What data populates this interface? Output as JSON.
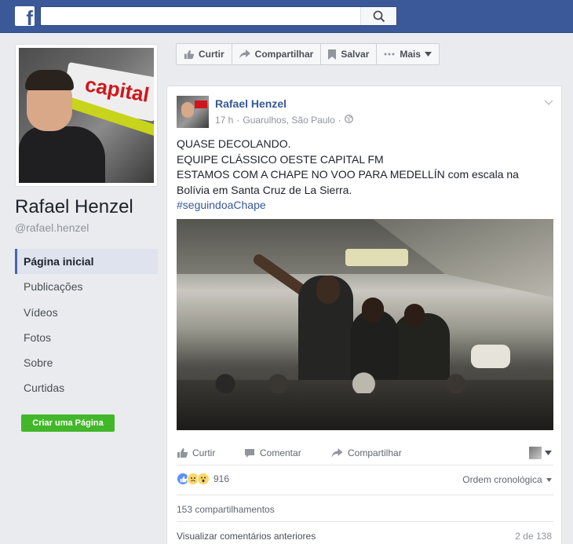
{
  "topbar": {
    "logo": "f",
    "search_placeholder": ""
  },
  "profile": {
    "name": "Rafael Henzel",
    "handle": "@rafael.henzel",
    "avatar_sign_text": "capital"
  },
  "nav": {
    "items": [
      {
        "label": "Página inicial",
        "active": true
      },
      {
        "label": "Publicações",
        "active": false
      },
      {
        "label": "Vídeos",
        "active": false
      },
      {
        "label": "Fotos",
        "active": false
      },
      {
        "label": "Sobre",
        "active": false
      },
      {
        "label": "Curtidas",
        "active": false
      }
    ],
    "create_page_label": "Criar uma Página"
  },
  "actionbar": {
    "like_label": "Curtir",
    "share_label": "Compartilhar",
    "save_label": "Salvar",
    "more_label": "Mais"
  },
  "post": {
    "author": "Rafael Henzel",
    "time": "17 h",
    "location": "Guarulhos, São Paulo",
    "lines": [
      "QUASE DECOLANDO.",
      "EQUIPE CLÁSSICO OESTE CAPITAL FM",
      "ESTAMOS COM A CHAPE NO VOO PARA MEDELLÍN com escala na Bolívia em Santa Cruz de La Sierra."
    ],
    "hashtag": "#seguindoaChape",
    "actions": {
      "like": "Curtir",
      "comment": "Comentar",
      "share": "Compartilhar"
    },
    "reactions_count": "916",
    "order_label": "Ordem cronológica",
    "shares_label": "153 compartilhamentos",
    "prev_comments_label": "Visualizar comentários anteriores",
    "comments_page": "2 de 138"
  },
  "colors": {
    "brand": "#3b5998",
    "link": "#365899",
    "create_button": "#42b72a"
  }
}
